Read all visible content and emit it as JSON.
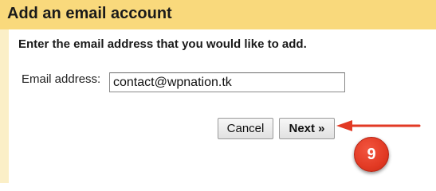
{
  "dialog": {
    "title": "Add an email account",
    "instruction": "Enter the email address that you would like to add."
  },
  "form": {
    "email_label": "Email address:",
    "email_value": "contact@wpnation.tk"
  },
  "buttons": {
    "cancel_label": "Cancel",
    "next_label": "Next »"
  },
  "annotation": {
    "step_number": "9",
    "arrow_icon": "red-arrow-left-icon",
    "color": "#e23a24"
  },
  "colors": {
    "title_bar": "#f9d97c",
    "dialog_background": "#fbefc7"
  }
}
